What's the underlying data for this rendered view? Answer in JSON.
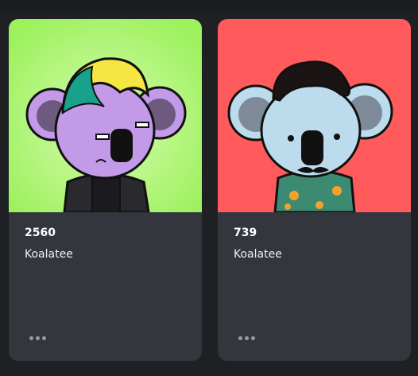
{
  "cards": [
    {
      "token_id": "2560",
      "collection": "Koalatee",
      "art": {
        "background": "#9cf15d",
        "background_light": "#d8fbb0",
        "fur": "#c39ae8",
        "fur_dark": "#8a66b8",
        "hair": "#f5e642",
        "hair_alt": "#18a28c",
        "outfit": "#2a2a2e",
        "icon": "koala-nft-icon"
      },
      "more_icon": "more-dots-icon"
    },
    {
      "token_id": "739",
      "collection": "Koalatee",
      "art": {
        "background": "#ff5a5c",
        "fur": "#bcdbec",
        "fur_dark": "#7e8a99",
        "hair": "#1a1414",
        "outfit": "#3d8a73",
        "icon": "koala-nft-icon"
      },
      "more_icon": "more-dots-icon"
    }
  ]
}
